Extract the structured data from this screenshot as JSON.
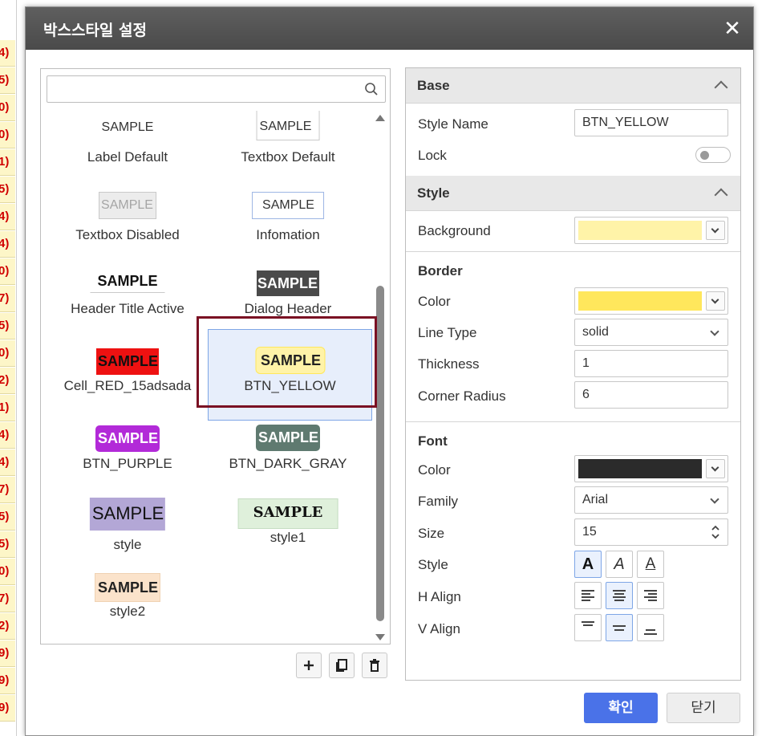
{
  "background_sheet": {
    "cells": [
      "4)",
      "5)",
      "0)",
      "0)",
      "1)",
      "5)",
      "4)",
      "4)",
      "0)",
      "7)",
      "5)",
      "0)",
      "2)",
      "1)",
      "4)",
      "4)",
      "7)",
      "5)",
      "5)",
      "0)",
      "7)",
      "2)",
      "9)",
      "9)",
      "9)"
    ]
  },
  "dialog": {
    "title": "박스스타일 설정",
    "close_glyph": "✕"
  },
  "search": {
    "placeholder": "",
    "value": ""
  },
  "styles": [
    {
      "sample": "SAMPLE",
      "name": "Label Default"
    },
    {
      "sample": "SAMPLE",
      "name": "Textbox Default"
    },
    {
      "sample": "SAMPLE",
      "name": "Textbox Disabled"
    },
    {
      "sample": "SAMPLE",
      "name": "Infomation"
    },
    {
      "sample": "SAMPLE",
      "name": "Header Title Active"
    },
    {
      "sample": "SAMPLE",
      "name": "Dialog Header"
    },
    {
      "sample": "SAMPLE",
      "name": "Cell_RED_15adsada"
    },
    {
      "sample": "SAMPLE",
      "name": "BTN_YELLOW"
    },
    {
      "sample": "SAMPLE",
      "name": "BTN_PURPLE"
    },
    {
      "sample": "SAMPLE",
      "name": "BTN_DARK_GRAY"
    },
    {
      "sample": "SAMPLE",
      "name": "style"
    },
    {
      "sample": "SAMPLE",
      "name": "style1"
    },
    {
      "sample": "SAMPLE",
      "name": "style2"
    }
  ],
  "selected_style": "BTN_YELLOW",
  "list_actions": {
    "add_icon": "plus-icon",
    "copy_icon": "copy-icon",
    "delete_icon": "trash-icon"
  },
  "properties": {
    "base": {
      "title": "Base",
      "style_name_label": "Style Name",
      "style_name_value": "BTN_YELLOW",
      "lock_label": "Lock",
      "lock_on": false
    },
    "style": {
      "title": "Style",
      "background_label": "Background",
      "background_color": "#fff3a8",
      "border": {
        "title": "Border",
        "color_label": "Color",
        "color": "#ffe75c",
        "line_type_label": "Line Type",
        "line_type": "solid",
        "thickness_label": "Thickness",
        "thickness": "1",
        "corner_radius_label": "Corner Radius",
        "corner_radius": "6"
      },
      "font": {
        "title": "Font",
        "color_label": "Color",
        "color": "#2b2b2b",
        "family_label": "Family",
        "family": "Arial",
        "size_label": "Size",
        "size": "15",
        "style_label": "Style",
        "style_buttons": [
          "A",
          "A",
          "A"
        ],
        "style_active": "bold",
        "h_align_label": "H Align",
        "h_align": "center",
        "v_align_label": "V Align",
        "v_align": "middle"
      }
    }
  },
  "buttons": {
    "ok": "확인",
    "close": "닫기"
  }
}
